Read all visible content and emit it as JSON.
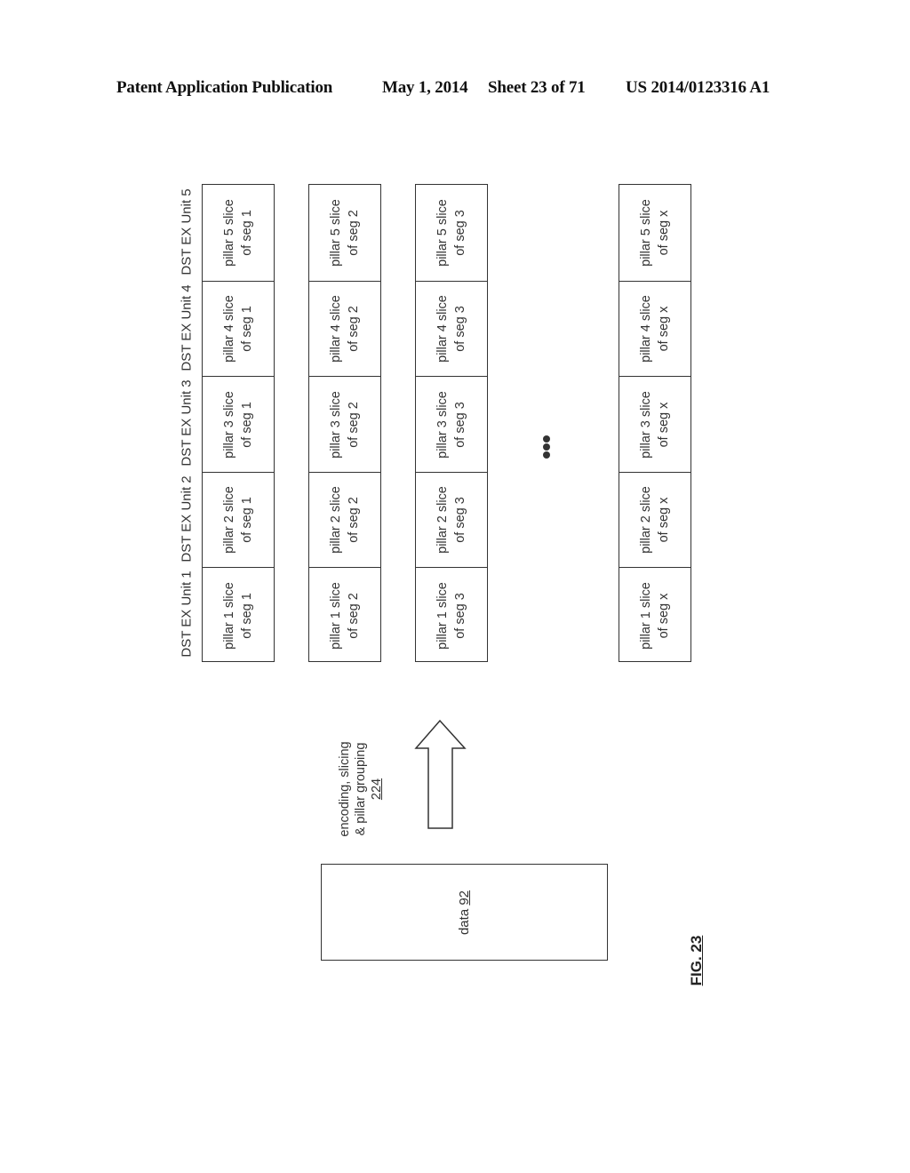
{
  "header": {
    "publication": "Patent Application Publication",
    "date": "May 1, 2014",
    "sheet": "Sheet 23 of 71",
    "number": "US 2014/0123316 A1"
  },
  "figure": {
    "label": "FIG. 23",
    "units": [
      "DST EX Unit 1",
      "DST EX Unit 2",
      "DST EX Unit 3",
      "DST EX Unit 4",
      "DST EX Unit 5"
    ],
    "segments": [
      {
        "cells": [
          [
            "pillar 1 slice",
            "of seg 1"
          ],
          [
            "pillar 2 slice",
            "of seg 1"
          ],
          [
            "pillar 3 slice",
            "of seg 1"
          ],
          [
            "pillar 4 slice",
            "of seg 1"
          ],
          [
            "pillar 5 slice",
            "of seg 1"
          ]
        ]
      },
      {
        "cells": [
          [
            "pillar 1 slice",
            "of seg 2"
          ],
          [
            "pillar 2 slice",
            "of seg 2"
          ],
          [
            "pillar 3 slice",
            "of seg 2"
          ],
          [
            "pillar 4 slice",
            "of seg 2"
          ],
          [
            "pillar 5 slice",
            "of seg 2"
          ]
        ]
      },
      {
        "cells": [
          [
            "pillar 1 slice",
            "of seg 3"
          ],
          [
            "pillar 2 slice",
            "of seg 3"
          ],
          [
            "pillar 3 slice",
            "of seg 3"
          ],
          [
            "pillar 4 slice",
            "of seg 3"
          ],
          [
            "pillar 5 slice",
            "of seg 3"
          ]
        ]
      },
      {
        "cells": [
          [
            "pillar 1 slice",
            "of seg x"
          ],
          [
            "pillar 2 slice",
            "of seg x"
          ],
          [
            "pillar 3 slice",
            "of seg x"
          ],
          [
            "pillar 4 slice",
            "of seg x"
          ],
          [
            "pillar 5 slice",
            "of seg x"
          ]
        ]
      }
    ],
    "arrow_label": {
      "line1": "encoding, slicing",
      "line2": "& pillar grouping",
      "ref": "224"
    },
    "data_box": {
      "label": "data",
      "ref": "92"
    },
    "ellipsis": "•••"
  }
}
